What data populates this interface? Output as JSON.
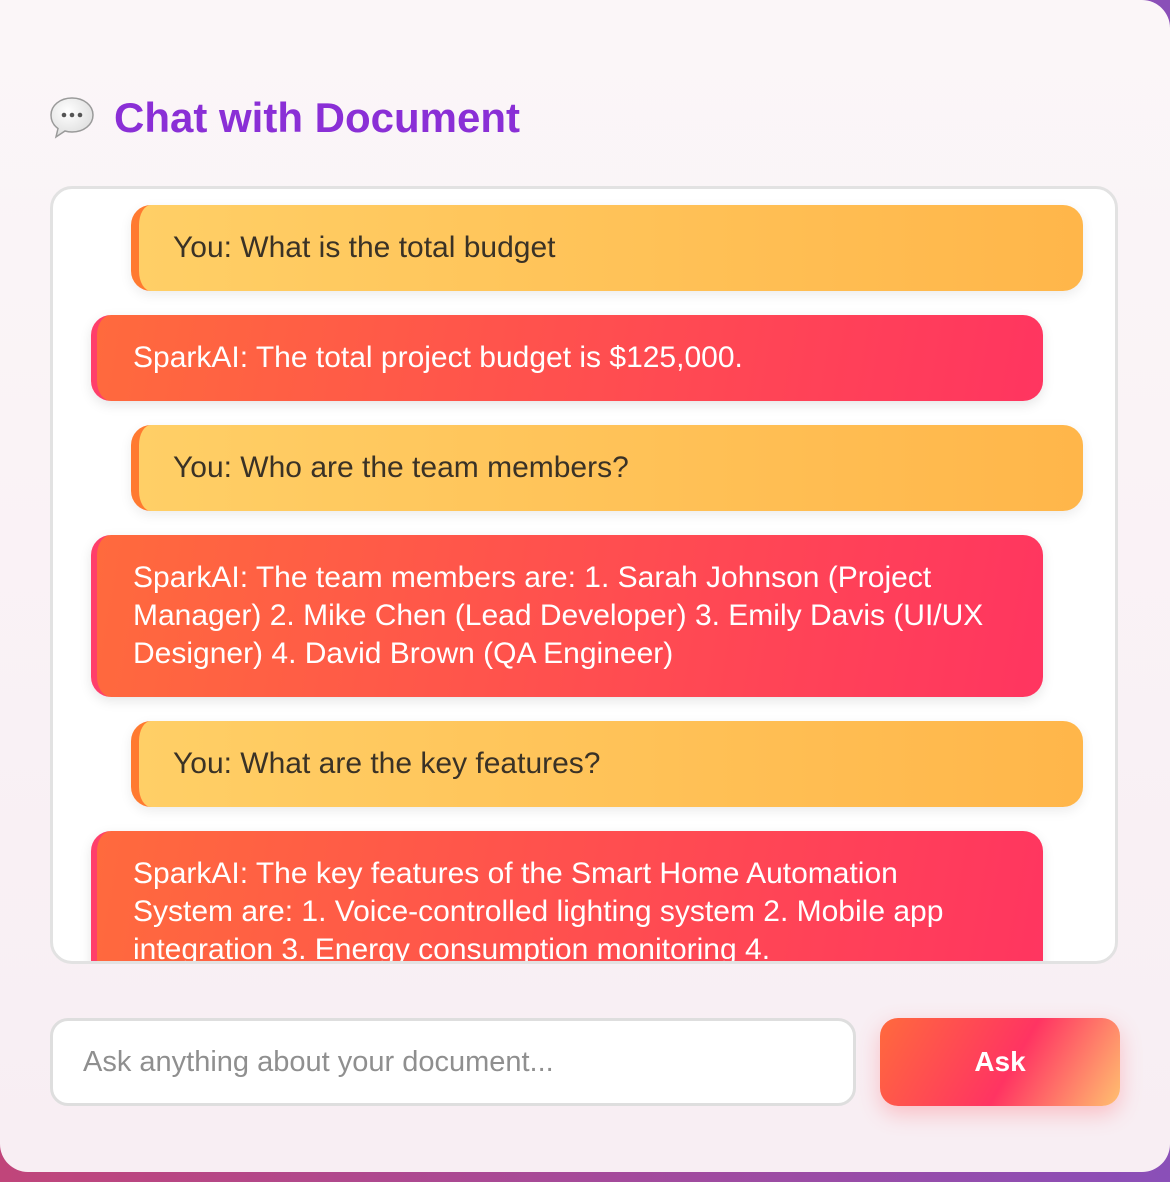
{
  "header": {
    "title": "Chat with Document",
    "icon": "speech-bubble-icon"
  },
  "messages": [
    {
      "role": "user",
      "text": "You: What is the total budget"
    },
    {
      "role": "ai",
      "text": "SparkAI: The total project budget is $125,000."
    },
    {
      "role": "user",
      "text": "You: Who are the team members?"
    },
    {
      "role": "ai",
      "text": "SparkAI: The team members are: 1. Sarah Johnson (Project Manager) 2. Mike Chen (Lead Developer) 3. Emily Davis (UI/UX Designer) 4. David Brown (QA Engineer)"
    },
    {
      "role": "user",
      "text": "You: What are the key features?"
    },
    {
      "role": "ai",
      "text": "SparkAI: The key features of the Smart Home Automation System are: 1. Voice-controlled lighting system 2. Mobile app integration 3. Energy consumption monitoring 4."
    }
  ],
  "input": {
    "placeholder": "Ask anything about your document...",
    "value": ""
  },
  "ask_button": {
    "label": "Ask"
  },
  "colors": {
    "title": "#8a2fd6",
    "user_bubble": "#ffc25a",
    "ai_bubble": "#ff4a55"
  }
}
